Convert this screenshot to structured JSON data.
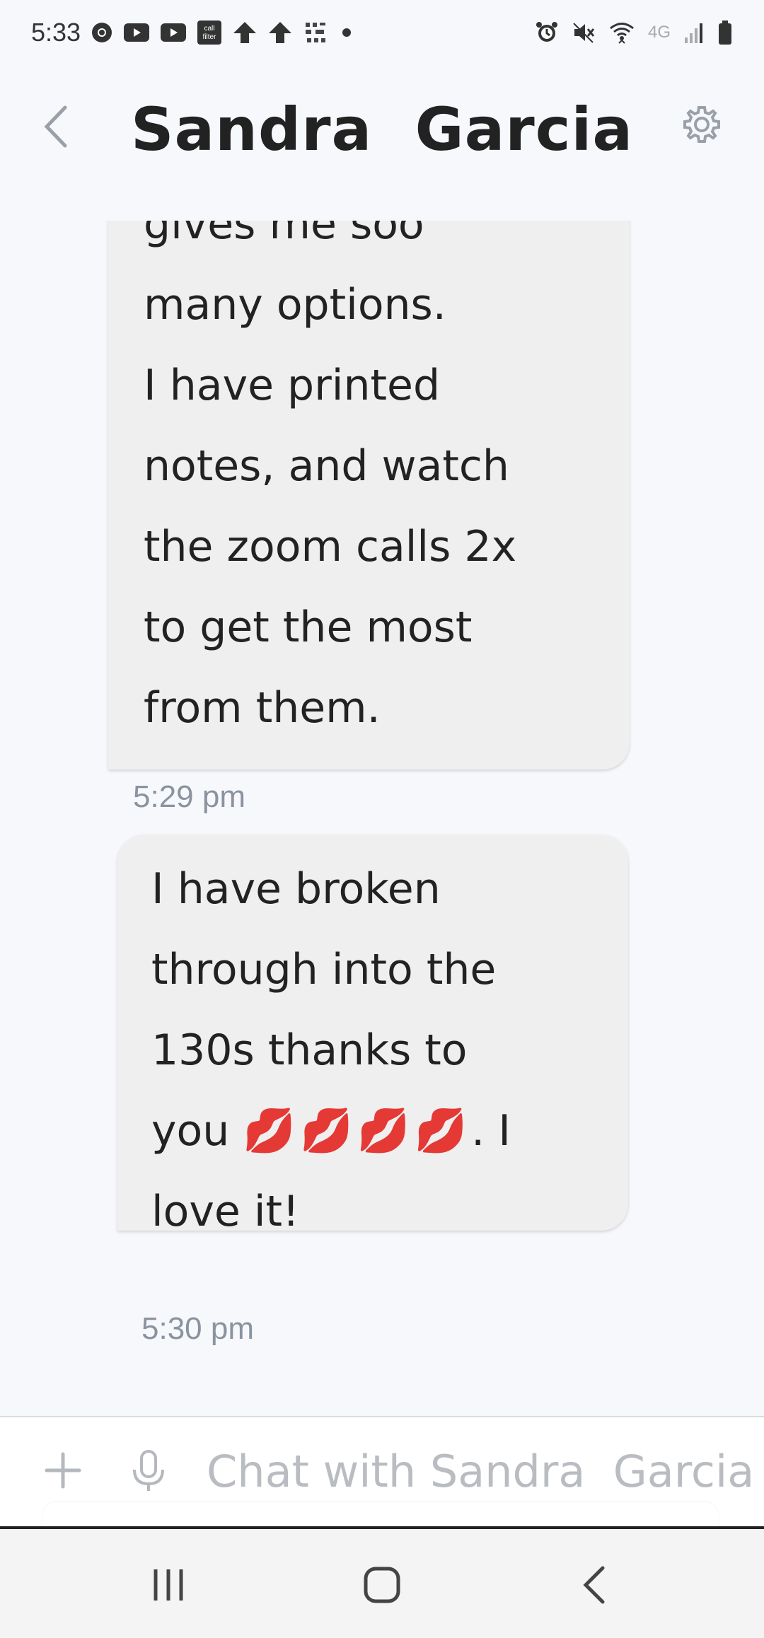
{
  "status_bar": {
    "time": "5:33",
    "left_icons": [
      "chrome-icon",
      "youtube-icon",
      "youtube-icon",
      "call-filter-icon",
      "arrow-icon",
      "arrow-icon",
      "app-icon",
      "dot-icon"
    ],
    "call_filter_label": "call\nfilter",
    "network": "4G",
    "right_icons": [
      "alarm-icon",
      "mute-icon",
      "wifi-icon",
      "signal-icon",
      "battery-icon"
    ]
  },
  "header": {
    "title": "Sandra  Garcia"
  },
  "messages": [
    {
      "lines": [
        "gives me soo",
        "many options.",
        "I have printed",
        "notes, and watch",
        "the zoom calls 2x",
        "to get the most",
        "from them."
      ],
      "time": "5:29 pm"
    },
    {
      "lines": [
        "I have broken",
        "through into the",
        "130s thanks to"
      ],
      "line4_prefix": "you ",
      "line4_emoji": "💋💋💋💋",
      "line4_suffix": ". I",
      "line5": "love it!",
      "time": "5:30 pm"
    }
  ],
  "composer": {
    "placeholder": "Chat with Sandra  Garcia"
  },
  "colors": {
    "background": "#f7f8fc",
    "bubble": "#efefef",
    "timestamp": "#8a93a0",
    "placeholder": "#b9bcc1"
  }
}
